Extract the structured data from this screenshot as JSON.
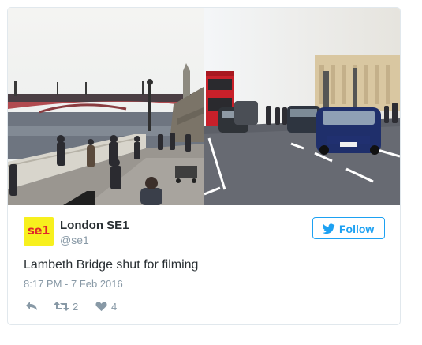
{
  "tweet": {
    "images": [
      {
        "icon": "bridge-photo",
        "description_id": "lambeth-bridge-crowd"
      },
      {
        "icon": "traffic-photo",
        "description_id": "bridge-traffic"
      }
    ],
    "author": {
      "logo_text": "se1",
      "name": "London SE1",
      "handle": "@se1"
    },
    "follow_label": "Follow",
    "text": "Lambeth Bridge shut for filming",
    "timestamp": "8:17 PM - 7 Feb 2016",
    "actions": {
      "retweet_count": "2",
      "like_count": "4"
    }
  },
  "colors": {
    "accent": "#1da1f2",
    "logo_bg": "#f7f01e",
    "logo_text": "#e0262a",
    "meta": "#8899a6",
    "text": "#292f33"
  }
}
